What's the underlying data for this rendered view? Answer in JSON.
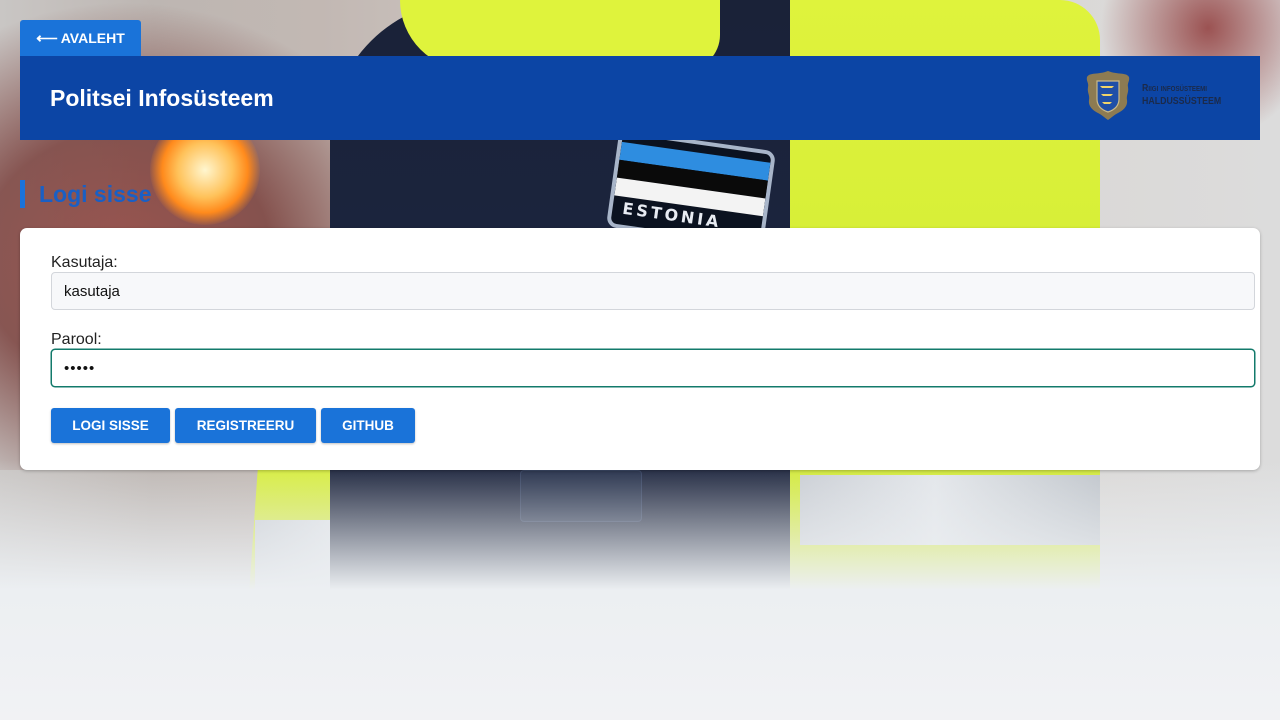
{
  "nav": {
    "back_label": "AVALEHT",
    "back_arrow": "⟵"
  },
  "header": {
    "title": "Politsei Infosüsteem",
    "brand_line1": "Riigi infosüsteemi",
    "brand_line2": "haldussüsteem",
    "crest_icon": "estonian-coat-of-arms-icon"
  },
  "section": {
    "title": "Logi sisse"
  },
  "form": {
    "username_label": "Kasutaja:",
    "username_value": "kasutaja",
    "password_label": "Parool:",
    "password_value": "•••••"
  },
  "buttons": {
    "login": "Logi sisse",
    "register": "Registreeru",
    "github": "GitHub"
  },
  "colors": {
    "primary": "#1a73d9",
    "header_bg": "#0c45a5",
    "section_title": "#1a5fc4",
    "focus_border": "#137a6b"
  }
}
